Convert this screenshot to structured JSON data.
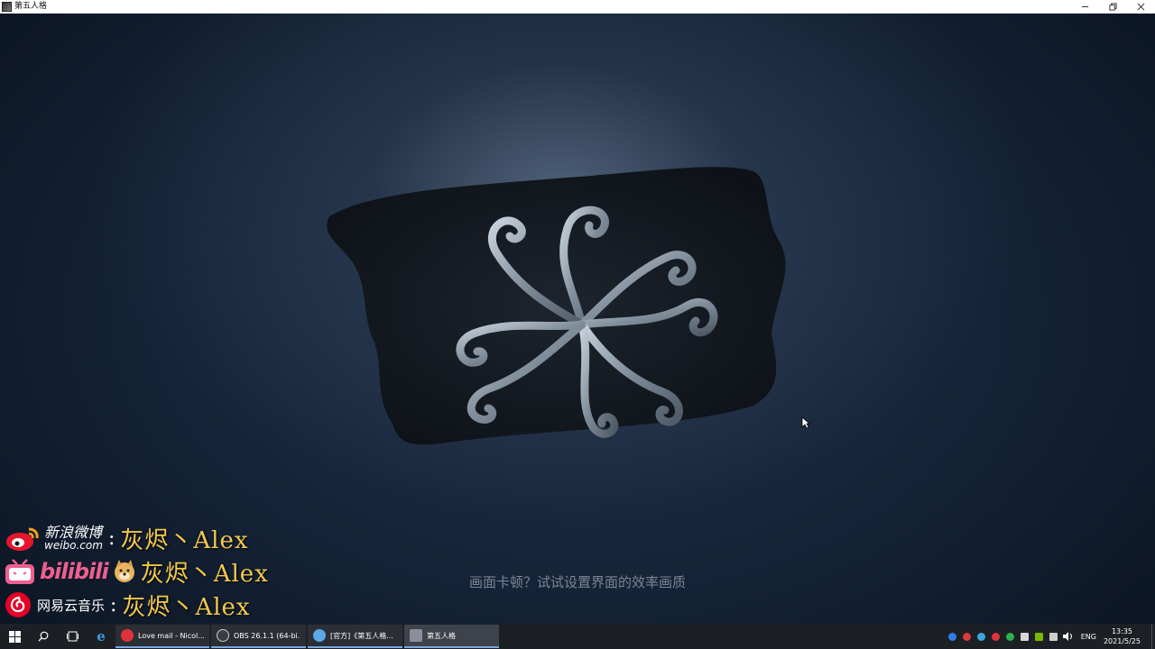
{
  "window": {
    "title": "第五人格"
  },
  "game": {
    "hint": "画面卡顿？试试设置界面的效率画质"
  },
  "overlay": {
    "weibo_cn": "新浪微博",
    "weibo_en": "weibo.com",
    "bilibili": "bilibili",
    "netease": "网易云音乐",
    "colon": ":",
    "handle": "灰烬丶Alex"
  },
  "taskbar": {
    "apps": [
      {
        "label": "Love mail - Nicol...",
        "color": "#e0323c"
      },
      {
        "label": "OBS 26.1.1 (64-bi...",
        "color": "#3a3d42"
      },
      {
        "label": "[官方]《第五人格...",
        "color": "#5aa9e6"
      },
      {
        "label": "第五人格",
        "color": "#8a8f99"
      }
    ],
    "lang": "ENG",
    "time": "13:35",
    "date": "2021/5/25"
  },
  "colors": {
    "handle": "#f3c84b",
    "bilibili": "#ef5f8f",
    "weibo": "#e6162d",
    "netease": "#e60026"
  }
}
